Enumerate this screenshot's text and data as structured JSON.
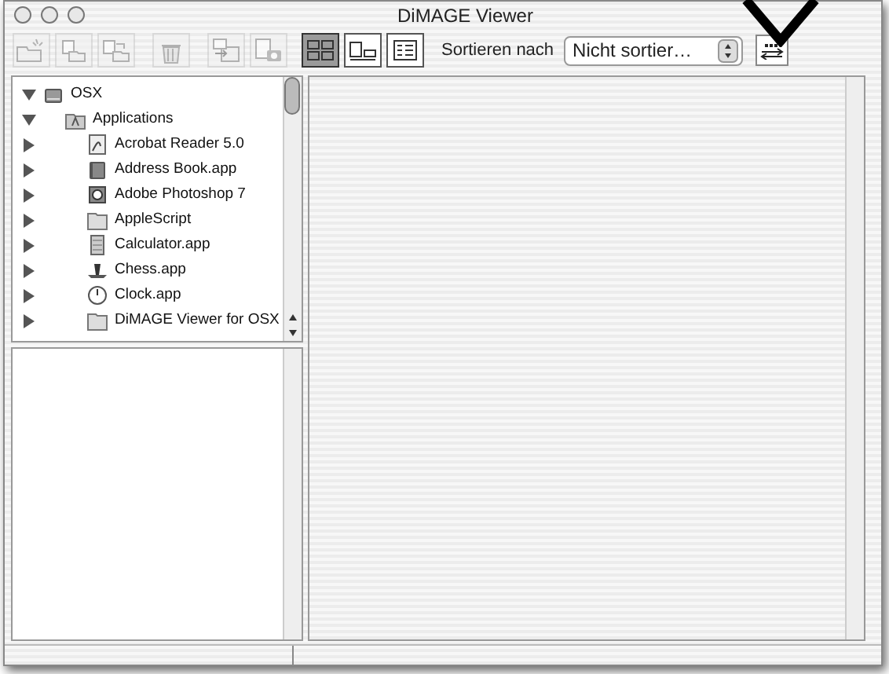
{
  "window": {
    "title": "DiMAGE Viewer"
  },
  "toolbar": [
    {
      "kind": "new-folder",
      "disabled": true
    },
    {
      "kind": "copy",
      "disabled": true
    },
    {
      "kind": "move",
      "disabled": true
    },
    {
      "kind": "trash",
      "disabled": true
    },
    {
      "kind": "import",
      "disabled": true
    },
    {
      "kind": "camera",
      "disabled": true
    }
  ],
  "view_buttons": [
    {
      "kind": "grid",
      "selected": true
    },
    {
      "kind": "detail",
      "selected": false
    },
    {
      "kind": "list",
      "selected": false
    }
  ],
  "sort": {
    "label": "Sortieren nach",
    "value": "Nicht sortier…"
  },
  "tree": [
    {
      "label": "OSX",
      "kind": "disk",
      "expanded": true,
      "children": [
        {
          "label": "Applications",
          "kind": "apps",
          "expanded": true,
          "children": [
            {
              "label": "Acrobat Reader 5.0",
              "kind": "acrobat",
              "expanded": false
            },
            {
              "label": "Address Book.app",
              "kind": "book",
              "expanded": false
            },
            {
              "label": "Adobe Photoshop 7",
              "kind": "photoshop",
              "expanded": false
            },
            {
              "label": "AppleScript",
              "kind": "folder",
              "expanded": false
            },
            {
              "label": "Calculator.app",
              "kind": "calculator",
              "expanded": false
            },
            {
              "label": "Chess.app",
              "kind": "chess",
              "expanded": false
            },
            {
              "label": "Clock.app",
              "kind": "clock",
              "expanded": false
            },
            {
              "label": "DiMAGE Viewer for OSX",
              "kind": "folder",
              "expanded": false
            }
          ]
        }
      ]
    }
  ]
}
